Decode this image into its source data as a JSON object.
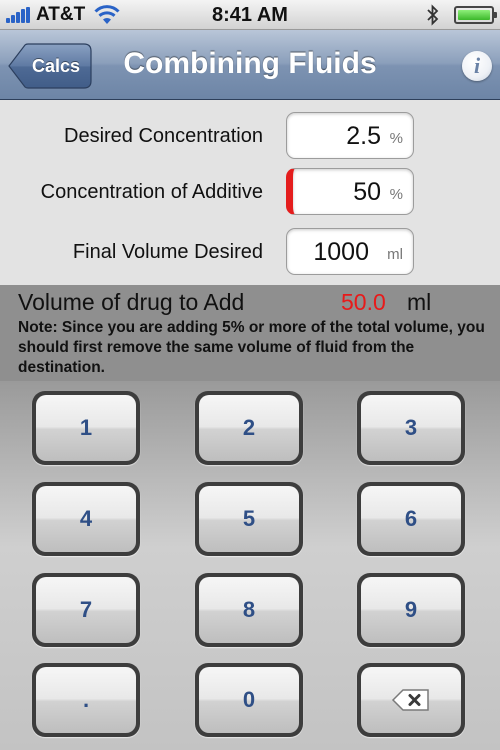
{
  "status_bar": {
    "carrier": "AT&T",
    "time": "8:41 AM",
    "icons": [
      "signal-icon",
      "wifi-icon",
      "bluetooth-icon",
      "battery-icon"
    ]
  },
  "nav": {
    "back_label": "Calcs",
    "title": "Combining Fluids",
    "info_label": "i"
  },
  "form": {
    "desired_concentration": {
      "label": "Desired Concentration",
      "value": "2.5",
      "unit": "%"
    },
    "concentration_of_additive": {
      "label": "Concentration of Additive",
      "value": "50",
      "unit": "%"
    },
    "final_volume": {
      "label": "Final Volume Desired",
      "value": "1000",
      "unit": "ml"
    }
  },
  "result": {
    "label": "Volume of drug to Add",
    "value": "50.0",
    "unit": "ml",
    "note": "Note: Since you are adding 5% or more of the total volume, you should first remove the same volume of fluid from the destination."
  },
  "keypad": {
    "keys": [
      "1",
      "2",
      "3",
      "4",
      "5",
      "6",
      "7",
      "8",
      "9",
      ".",
      "0"
    ],
    "backspace_icon": "backspace-icon"
  },
  "colors": {
    "nav_bar": "#7d93b2",
    "result_value": "#e81a1a",
    "active_field_marker": "#e41d1d",
    "key_text": "#2f4f86"
  }
}
